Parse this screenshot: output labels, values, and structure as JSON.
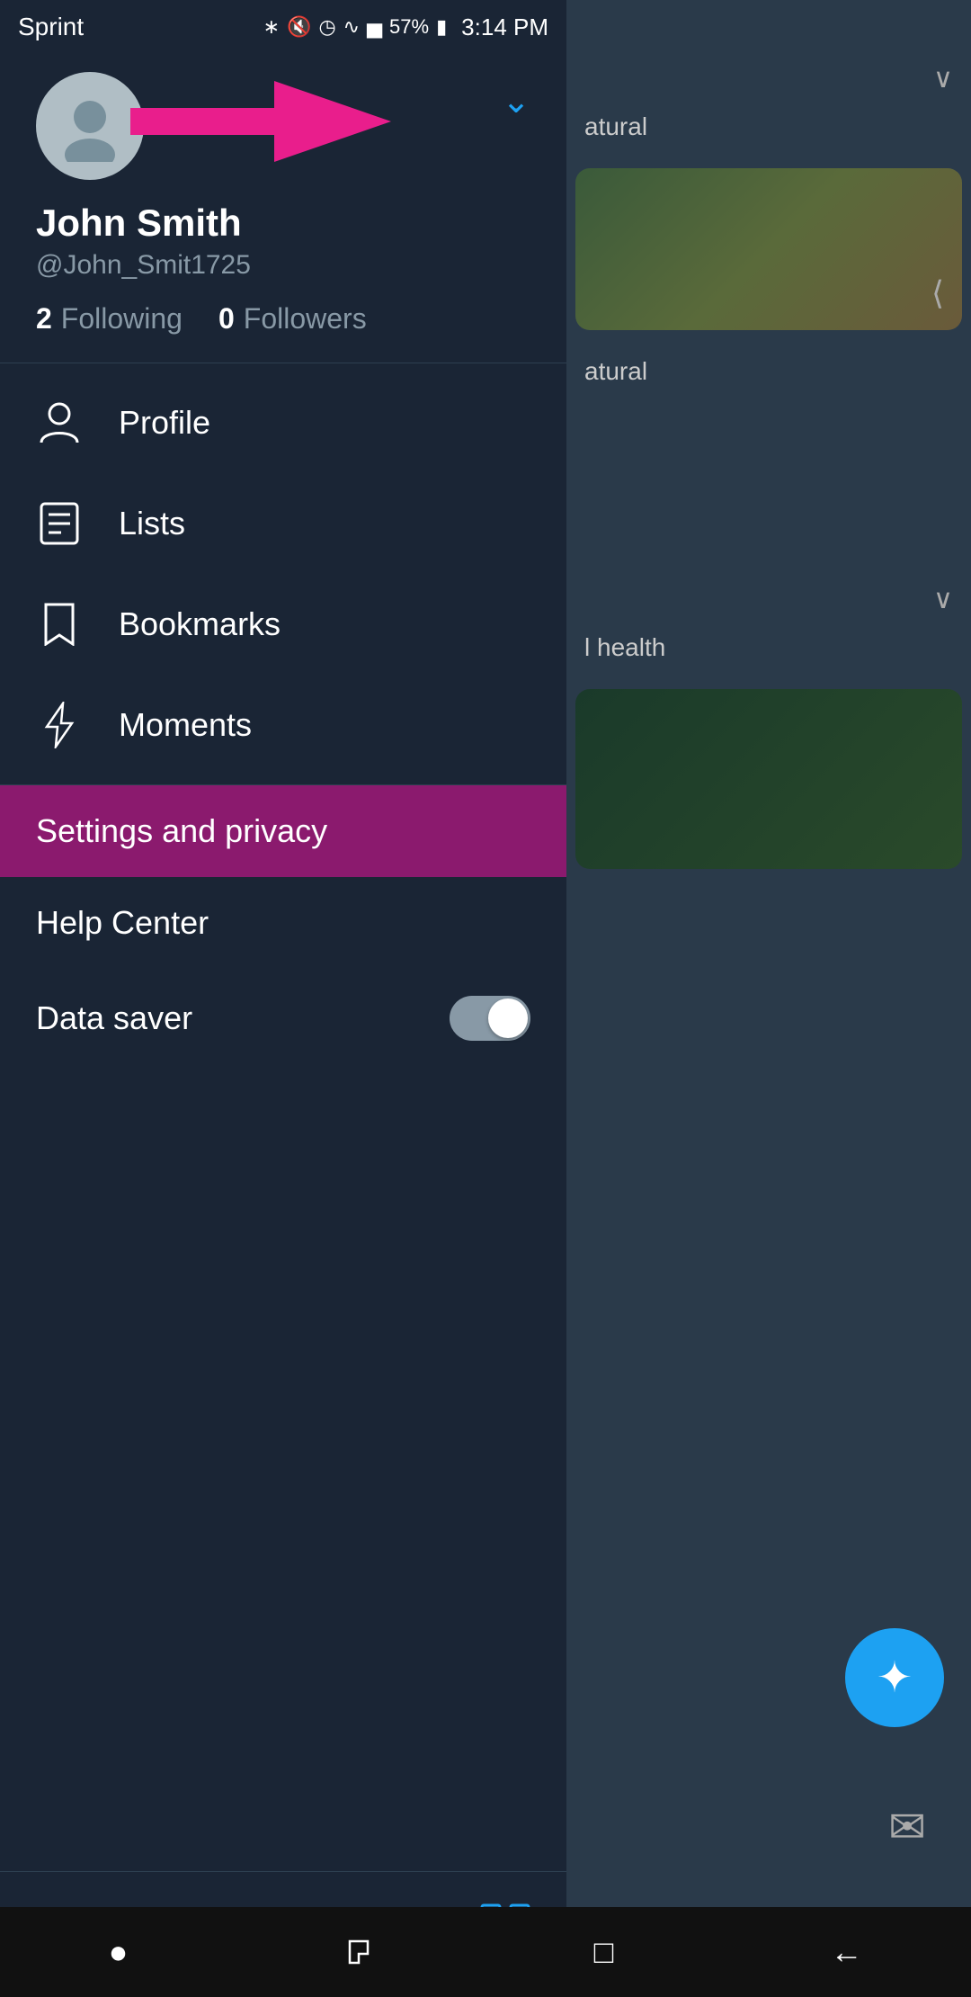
{
  "statusBar": {
    "carrier": "Sprint",
    "time": "3:14 PM",
    "battery": "57%",
    "icons": [
      "bluetooth",
      "muted",
      "alarm",
      "wifi",
      "signal"
    ]
  },
  "profile": {
    "name": "John Smith",
    "handle": "@John_Smit1725",
    "following_count": "2",
    "following_label": "Following",
    "followers_count": "0",
    "followers_label": "Followers"
  },
  "menu": {
    "items": [
      {
        "id": "profile",
        "label": "Profile",
        "icon": "person"
      },
      {
        "id": "lists",
        "label": "Lists",
        "icon": "lists"
      },
      {
        "id": "bookmarks",
        "label": "Bookmarks",
        "icon": "bookmark"
      },
      {
        "id": "moments",
        "label": "Moments",
        "icon": "bolt"
      }
    ]
  },
  "bottomMenu": {
    "settings_label": "Settings and privacy",
    "help_label": "Help Center",
    "data_saver_label": "Data saver",
    "data_saver_enabled": false
  },
  "androidNav": {
    "back_label": "←",
    "home_label": "○",
    "recent_label": "□",
    "recents_label": "⊏"
  }
}
